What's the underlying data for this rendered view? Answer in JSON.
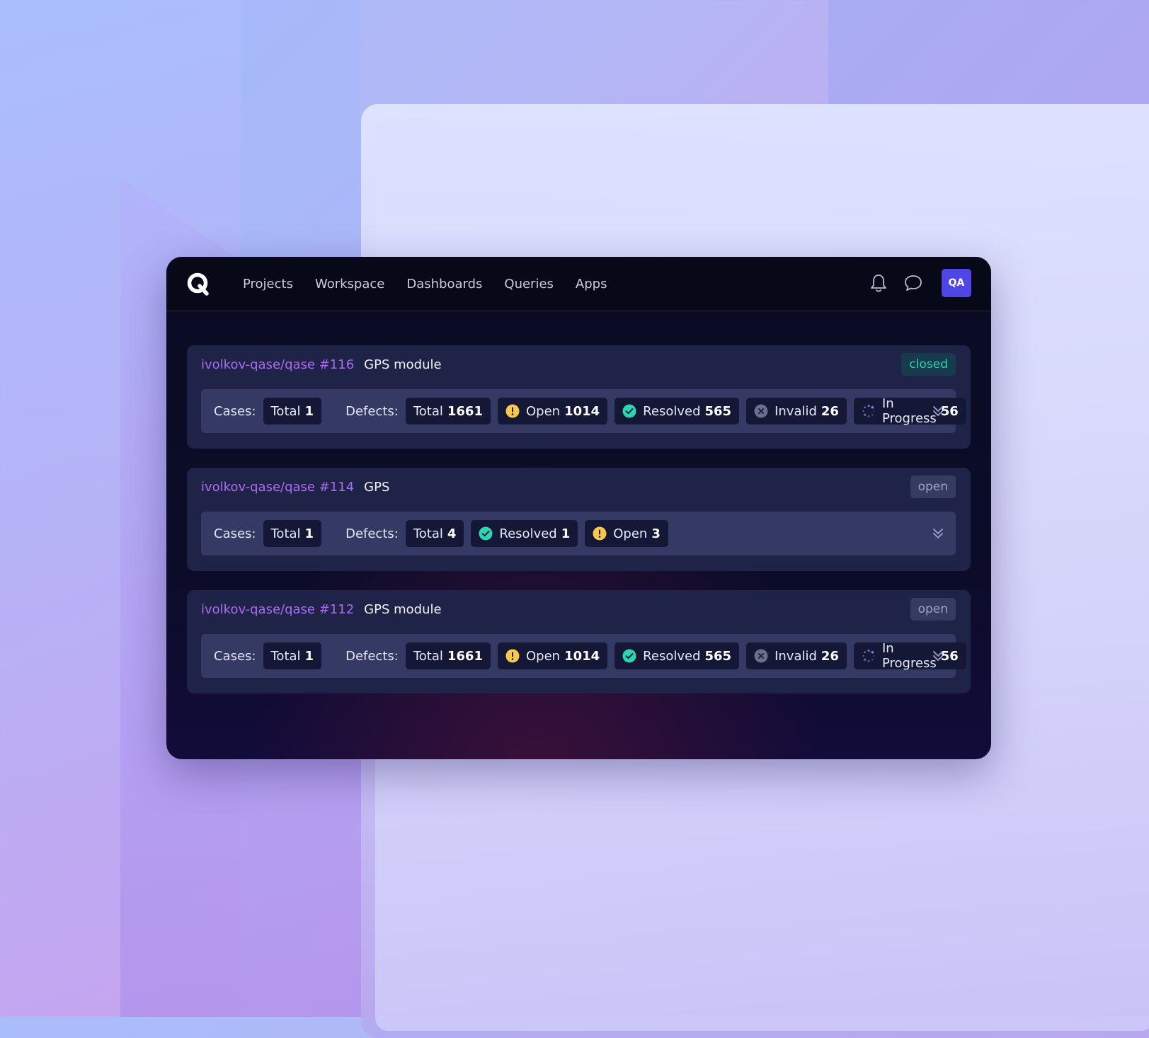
{
  "nav": {
    "items": [
      "Projects",
      "Workspace",
      "Dashboards",
      "Queries",
      "Apps"
    ]
  },
  "user": {
    "initials": "QA"
  },
  "labels": {
    "cases": "Cases:",
    "defects": "Defects:"
  },
  "colors": {
    "accent": "#4f46e5",
    "repo_link": "#a96cf0",
    "status_closed": "#2ed3b0",
    "open_warning": "#f7c94a",
    "resolved": "#2ed3b0",
    "invalid": "#6b6f8c",
    "in_progress": "#a78bfa"
  },
  "cards": [
    {
      "repo": "ivolkov-qase/qase #116",
      "title": "GPS module",
      "status": "closed",
      "cases": {
        "label": "Total",
        "value": "1"
      },
      "defects": [
        {
          "type": "total",
          "label": "Total",
          "value": "1661",
          "icon": ""
        },
        {
          "type": "open",
          "label": "Open",
          "value": "1014",
          "icon": "warning-icon"
        },
        {
          "type": "resolved",
          "label": "Resolved",
          "value": "565",
          "icon": "check-circle-icon"
        },
        {
          "type": "invalid",
          "label": "Invalid",
          "value": "26",
          "icon": "x-circle-icon"
        },
        {
          "type": "progress",
          "label": "In Progress",
          "value": "56",
          "icon": "spinner-icon"
        }
      ]
    },
    {
      "repo": "ivolkov-qase/qase #114",
      "title": "GPS",
      "status": "open",
      "cases": {
        "label": "Total",
        "value": "1"
      },
      "defects": [
        {
          "type": "total",
          "label": "Total",
          "value": "4",
          "icon": ""
        },
        {
          "type": "resolved",
          "label": "Resolved",
          "value": "1",
          "icon": "check-circle-icon"
        },
        {
          "type": "open",
          "label": "Open",
          "value": "3",
          "icon": "warning-icon"
        }
      ]
    },
    {
      "repo": "ivolkov-qase/qase #112",
      "title": "GPS module",
      "status": "open",
      "cases": {
        "label": "Total",
        "value": "1"
      },
      "defects": [
        {
          "type": "total",
          "label": "Total",
          "value": "1661",
          "icon": ""
        },
        {
          "type": "open",
          "label": "Open",
          "value": "1014",
          "icon": "warning-icon"
        },
        {
          "type": "resolved",
          "label": "Resolved",
          "value": "565",
          "icon": "check-circle-icon"
        },
        {
          "type": "invalid",
          "label": "Invalid",
          "value": "26",
          "icon": "x-circle-icon"
        },
        {
          "type": "progress",
          "label": "In Progress",
          "value": "56",
          "icon": "spinner-icon"
        }
      ]
    }
  ]
}
